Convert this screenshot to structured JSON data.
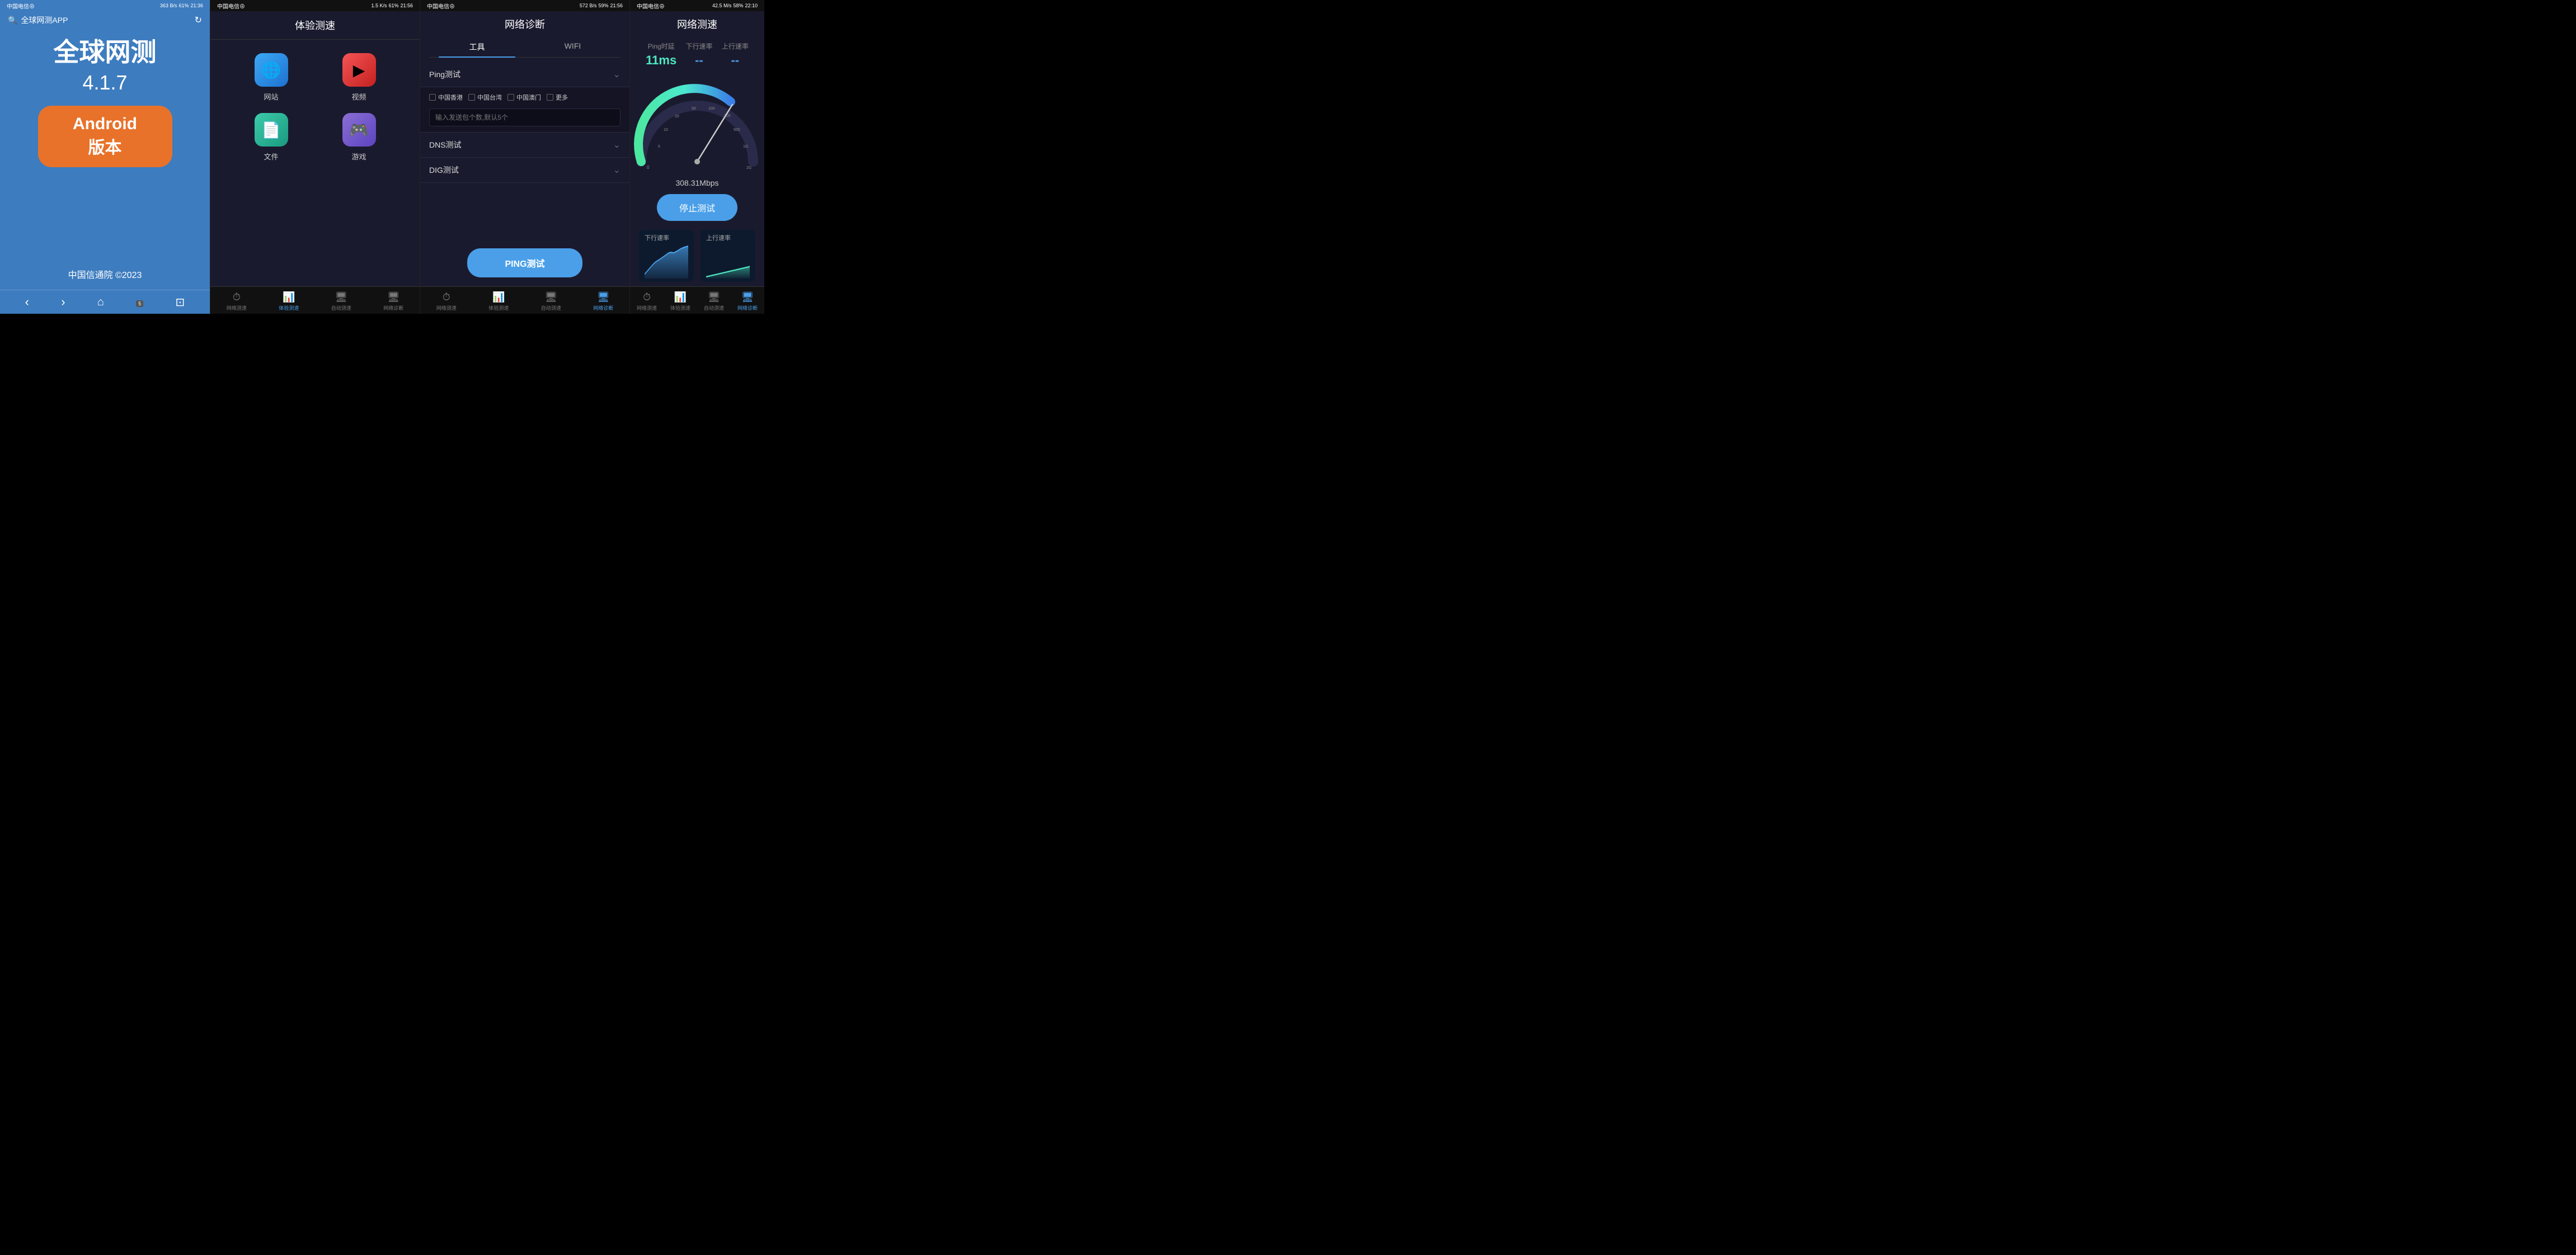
{
  "panel1": {
    "status_bar": {
      "carrier": "中国电信⊕",
      "signal": "46",
      "wifi": "📶",
      "speed": "363 B/s",
      "battery_icon": "🔋",
      "battery": "61%",
      "time": "21:36"
    },
    "search_label": "全球网测APP",
    "title_line1": "全球网测",
    "version": "4.1.7",
    "badge_line1": "Android",
    "badge_line2": "版本",
    "copyright": "中国信通院 ©2023",
    "nav": {
      "back": "‹",
      "forward": "›",
      "home": "⌂",
      "tabs": "5",
      "menu": "⊡"
    }
  },
  "panel2": {
    "status_bar": {
      "carrier": "中国电信⊕",
      "speed": "1.5 K/s",
      "battery": "61%",
      "time": "21:56"
    },
    "title": "体验测速",
    "icons": [
      {
        "label": "网站",
        "icon": "🌐",
        "style": "icon-box-blue"
      },
      {
        "label": "视频",
        "icon": "▶",
        "style": "icon-box-red"
      },
      {
        "label": "文件",
        "icon": "📄",
        "style": "icon-box-teal"
      },
      {
        "label": "游戏",
        "icon": "🎮",
        "style": "icon-box-purple"
      }
    ],
    "tabs": [
      {
        "label": "网络测速",
        "icon": "⏱",
        "active": false
      },
      {
        "label": "体验测速",
        "icon": "📊",
        "active": true
      },
      {
        "label": "自动测速",
        "icon": "🖥",
        "active": false
      },
      {
        "label": "网络诊断",
        "icon": "🖥",
        "active": false
      }
    ]
  },
  "panel3": {
    "status_bar": {
      "carrier": "中国电信⊕",
      "speed": "572 B/s",
      "battery": "59%",
      "time": "21:56"
    },
    "title": "网络诊断",
    "tabs": [
      {
        "label": "工具",
        "active": true
      },
      {
        "label": "WIFI",
        "active": false
      }
    ],
    "sections": [
      {
        "title": "Ping测试",
        "expanded": true,
        "checkboxes": [
          "中国香港",
          "中国台湾",
          "中国澳门",
          "更多"
        ],
        "input_placeholder": "输入发送包个数,默认5个"
      },
      {
        "title": "DNS测试",
        "expanded": false
      },
      {
        "title": "DIG测试",
        "expanded": false
      }
    ],
    "ping_btn_label": "PING测试",
    "tabs_bottom": [
      {
        "label": "网络测速",
        "icon": "⏱",
        "active": false
      },
      {
        "label": "体验测速",
        "icon": "📊",
        "active": false
      },
      {
        "label": "自动测速",
        "icon": "🖥",
        "active": false
      },
      {
        "label": "网络诊断",
        "icon": "🖥",
        "active": true
      }
    ]
  },
  "panel4": {
    "status_bar": {
      "carrier": "中国电信⊕",
      "speed": "42.5 M/s",
      "battery": "58%",
      "time": "22:10"
    },
    "title": "网络测速",
    "metrics": [
      {
        "label": "Ping时延",
        "value": "11ms",
        "color": "#4ce8c0"
      },
      {
        "label": "下行速率",
        "value": "--",
        "color": "#4a9fe8"
      },
      {
        "label": "上行速率",
        "value": "--",
        "color": "#4a9fe8"
      }
    ],
    "speed_reading": "308.31Mbps",
    "stop_btn_label": "停止测试",
    "mini_chart_labels": [
      "下行速率",
      "上行速率"
    ],
    "tabs_bottom": [
      {
        "label": "网络测速",
        "icon": "⏱",
        "active": false
      },
      {
        "label": "体验测速",
        "icon": "📊",
        "active": false
      },
      {
        "label": "自动测速",
        "icon": "🖥",
        "active": false
      },
      {
        "label": "网络诊断",
        "icon": "🖥",
        "active": true
      }
    ],
    "speedometer": {
      "min": 0,
      "max": 500,
      "value": 308,
      "labels": [
        "0",
        "5",
        "10",
        "20",
        "50",
        "100",
        "200",
        "500"
      ]
    }
  }
}
